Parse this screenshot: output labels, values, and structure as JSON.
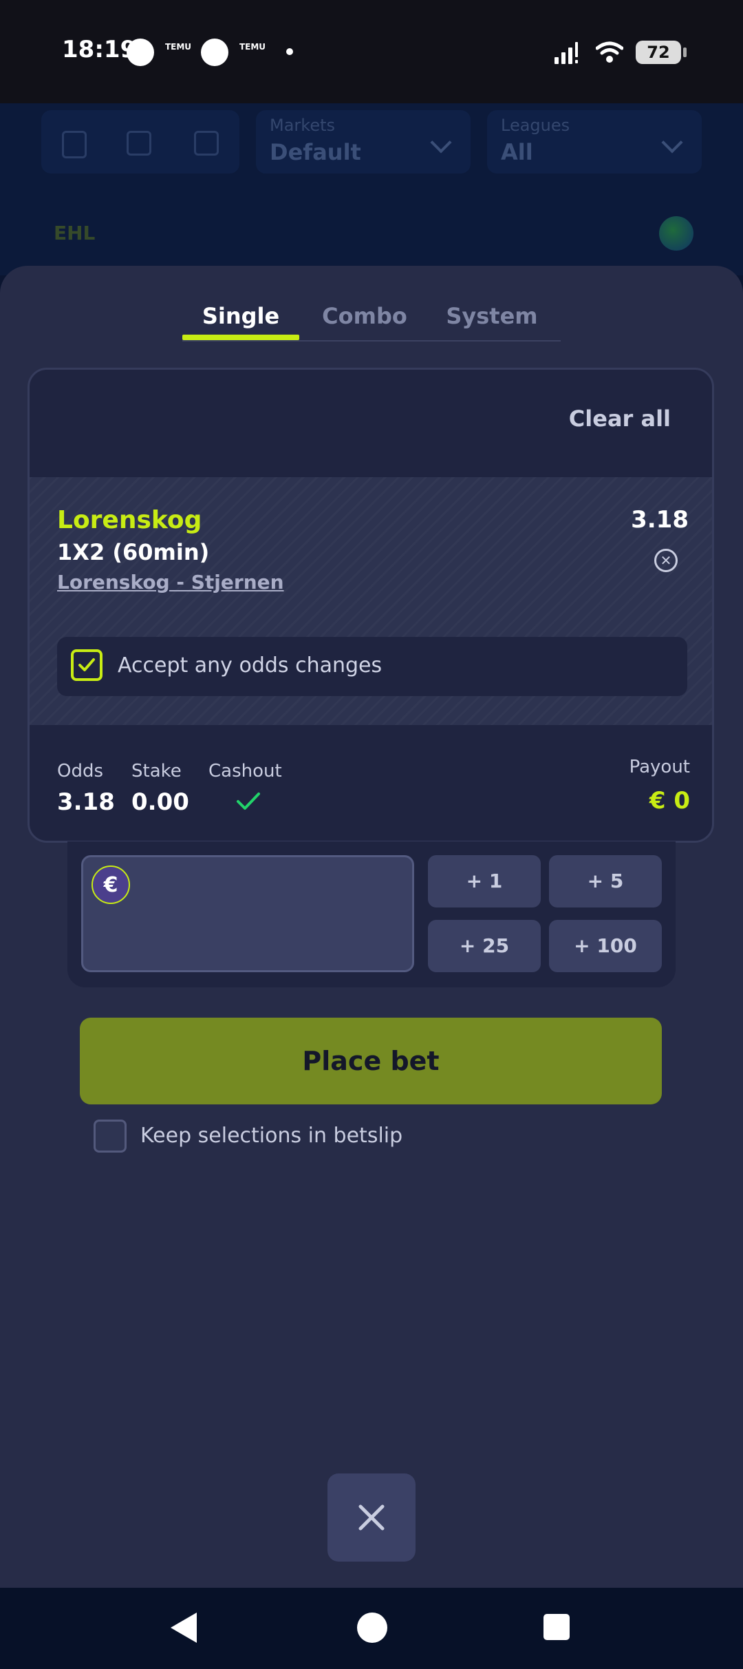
{
  "status_bar": {
    "time": "18:19",
    "notification_app_label": "TEMU",
    "battery_level": "72"
  },
  "background_app": {
    "markets_label": "Markets",
    "markets_value": "Default",
    "leagues_label": "Leagues",
    "leagues_value": "All",
    "league_name": "EHL"
  },
  "betslip": {
    "tabs": [
      "Single",
      "Combo",
      "System"
    ],
    "active_tab": "Single",
    "clear_all_label": "Clear all",
    "selection": {
      "team": "Lorenskog",
      "market": "1X2 (60min)",
      "event": "Lorenskog - Stjernen",
      "odds": "3.18"
    },
    "accept_odds_label": "Accept any odds changes",
    "accept_odds_checked": true,
    "summary": {
      "odds_label": "Odds",
      "odds_value": "3.18",
      "stake_label": "Stake",
      "stake_value": "0.00",
      "cashout_label": "Cashout",
      "payout_label": "Payout",
      "payout_value": "€  0"
    },
    "currency_symbol": "€",
    "quick_stakes": [
      "+ 1",
      "+ 5",
      "+ 25",
      "+ 100"
    ],
    "place_bet_label": "Place bet",
    "keep_selections_label": "Keep selections in betslip",
    "keep_selections_checked": false
  },
  "colors": {
    "accent": "#c8ec14",
    "place_bet": "#758a22",
    "sheet_bg": "#272c48",
    "cashout_check": "#22d36a"
  }
}
